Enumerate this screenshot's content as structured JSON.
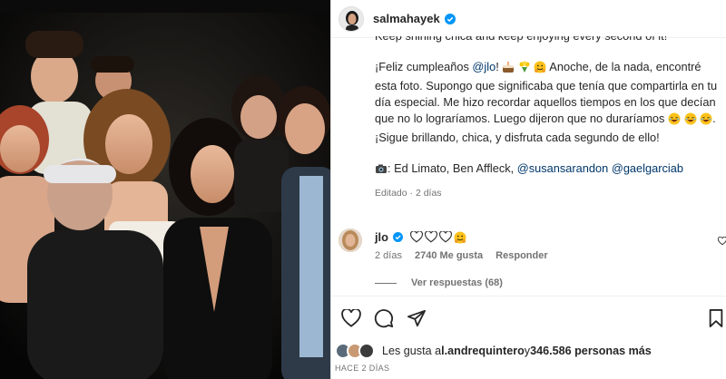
{
  "post": {
    "username": "salmahayek",
    "caption_cut_line": "Keep shining chica and keep enjoying every second of it!",
    "caption": {
      "p1_a": "¡Feliz cumpleaños ",
      "p1_mention": "@jlo",
      "p1_b": "! ",
      "p1_c": " Anoche, de la nada, encontré esta foto. Supongo que significaba que tenía que compartirla en tu día especial. Me hizo recordar aquellos tiempos en los que decían que no lo lograríamos. Luego dijeron que no duraríamos ",
      "p1_d": ". ¡Sigue brillando, chica, y disfruta cada segundo de ello!",
      "credits_a": ": Ed Limato, Ben Affleck, ",
      "credits_m1": "@susansarandon",
      "credits_sep": " ",
      "credits_m2": "@gaelgarciab"
    },
    "edited_meta": "Editado · 2 días"
  },
  "reply": {
    "username": "jlo",
    "time": "2 días",
    "likes": "2740 Me gusta",
    "respond": "Responder",
    "see_replies": "Ver respuestas (68)"
  },
  "likes": {
    "prefix": "Les gusta a ",
    "user": "l.andrequintero",
    "middle": " y ",
    "count": "346.586 personas más"
  },
  "date": "HACE 2 DÍAS",
  "icons": [
    "verified-badge-icon",
    "heart-icon",
    "comment-icon",
    "share-icon",
    "bookmark-icon",
    "camera-emoji",
    "cake-emoji",
    "bouquet-emoji",
    "hug-emoji",
    "laugh-emoji",
    "white-heart-emoji"
  ],
  "colors": {
    "mention": "#00376b",
    "verified": "#0095f6",
    "meta": "#737373"
  }
}
